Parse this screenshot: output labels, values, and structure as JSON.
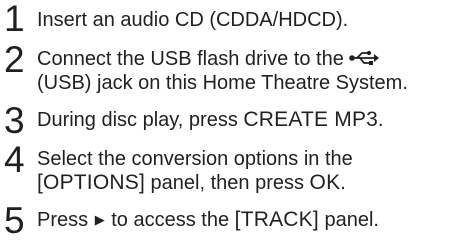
{
  "instructions": {
    "steps": [
      {
        "number": "1",
        "line1": "Insert an audio CD (CDDA/HDCD)."
      },
      {
        "number": "2",
        "line1_before_icon": "Connect the USB flash drive to the",
        "icon": "usb-icon",
        "line2": "(USB) jack on this Home Theatre System."
      },
      {
        "number": "3",
        "line1_text": "During disc play, press ",
        "line1_button": "CREATE MP3",
        "line1_end": "."
      },
      {
        "number": "4",
        "line1": "Select the conversion options in the",
        "line2_bracket": "[OPTIONS]",
        "line2_text": " panel, then press ",
        "line2_button": "OK",
        "line2_end": "."
      },
      {
        "number": "5",
        "line1_start": "Press ",
        "icon": "play-icon",
        "line1_middle": " to access the ",
        "line1_bracket": "[TRACK]",
        "line1_end": " panel."
      }
    ]
  }
}
